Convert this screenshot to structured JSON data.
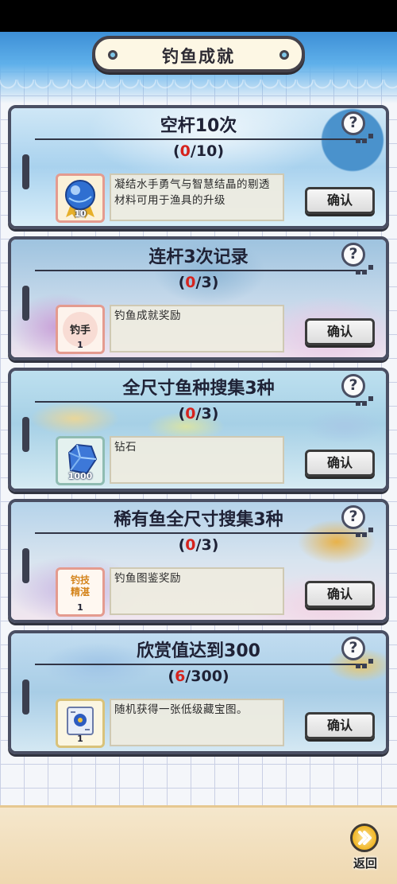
{
  "header": {
    "title": "钓鱼成就"
  },
  "achievements": [
    {
      "title": "空杆10次",
      "progress": {
        "current": "0",
        "total": "10"
      },
      "reward_icon": "blue-crystal-orb-icon",
      "reward_count": "10",
      "reward_desc": "凝结水手勇气与智慧结晶的剔透材料可用于渔具的升级",
      "button": "确认",
      "help": "?"
    },
    {
      "title": "连杆3次记录",
      "progress": {
        "current": "0",
        "total": "3"
      },
      "reward_icon": "angler-badge-icon",
      "reward_label": "钓手",
      "reward_count": "1",
      "reward_desc": "钓鱼成就奖励",
      "button": "确认",
      "help": "?"
    },
    {
      "title": "全尺寸鱼种搜集3种",
      "progress": {
        "current": "0",
        "total": "3"
      },
      "reward_icon": "diamond-icon",
      "reward_count": "1000",
      "reward_desc": "钻石",
      "button": "确认",
      "help": "?"
    },
    {
      "title": "稀有鱼全尺寸搜集3种",
      "progress": {
        "current": "0",
        "total": "3"
      },
      "reward_icon": "fishing-skill-badge-icon",
      "reward_label_top": "钓技",
      "reward_label_bottom": "精湛",
      "reward_count": "1",
      "reward_desc": "钓鱼图鉴奖励",
      "button": "确认",
      "help": "?"
    },
    {
      "title": "欣赏值达到300",
      "progress": {
        "current": "6",
        "total": "300"
      },
      "reward_icon": "treasure-map-icon",
      "reward_count": "1",
      "reward_desc": "随机获得一张低级藏宝图。",
      "button": "确认",
      "help": "?"
    }
  ],
  "footer": {
    "back_label": "返回"
  },
  "colors": {
    "progress_current": "#d6231d",
    "frame": "#4a4f63",
    "title_text": "#1f2236"
  }
}
